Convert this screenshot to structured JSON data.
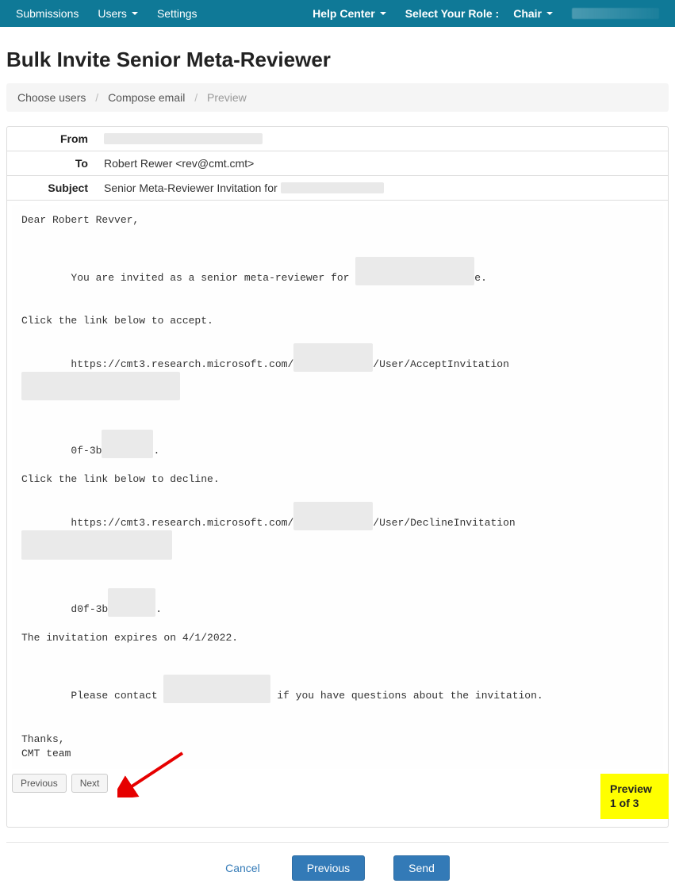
{
  "nav": {
    "submissions": "Submissions",
    "users": "Users",
    "settings": "Settings",
    "help_center": "Help Center",
    "select_role_label": "Select Your Role :",
    "role": "Chair",
    "hidden_user": "████████"
  },
  "page_title": "Bulk Invite Senior Meta-Reviewer",
  "breadcrumb": {
    "step1": "Choose users",
    "step2": "Compose email",
    "step3": "Preview"
  },
  "fields": {
    "from_label": "From",
    "from_value_obscured": "██████████████████████",
    "to_label": "To",
    "to_value": "Robert Rewer <rev@cmt.cmt>",
    "subject_label": "Subject",
    "subject_prefix": "Senior Meta-Reviewer Invitation for",
    "subject_obscured": "███████████████"
  },
  "body": {
    "greeting": "Dear Robert Revver,",
    "invited_prefix": "You are invited as a senior meta-reviewer for ",
    "invited_obscured": "████████████████████",
    "invited_suffix": "e.",
    "accept_intro": "Click the link below to accept.",
    "accept_url_prefix": "https://cmt3.research.microsoft.com/",
    "accept_url_ob1": "█████████████",
    "accept_url_mid": "/User/AcceptInvitation",
    "accept_url_ob2": "██████████████████████████████████",
    "accept_url_line2_prefix": "0f-3b",
    "accept_url_line2_ob": "██████████",
    "accept_url_line2_suffix": ".",
    "decline_intro": "Click the link below to decline.",
    "decline_url_prefix": "https://cmt3.research.microsoft.com/",
    "decline_url_ob1": "█████████████",
    "decline_url_mid": "/User/DeclineInvitation",
    "decline_url_ob2": "████████████████████████████████",
    "decline_url_line2_prefix": "d0f-3b",
    "decline_url_line2_ob": "█████████",
    "decline_url_line2_suffix": ".",
    "expires": "The invitation expires on 4/1/2022.",
    "contact_prefix": "Please contact ",
    "contact_ob": "████████████████████",
    "contact_suffix": " if you have questions about the invitation.",
    "thanks": "Thanks,",
    "signoff": "CMT team"
  },
  "pager": {
    "previous": "Previous",
    "next": "Next"
  },
  "preview_counter": "Preview 1 of 3",
  "footer": {
    "cancel": "Cancel",
    "previous": "Previous",
    "send": "Send"
  }
}
